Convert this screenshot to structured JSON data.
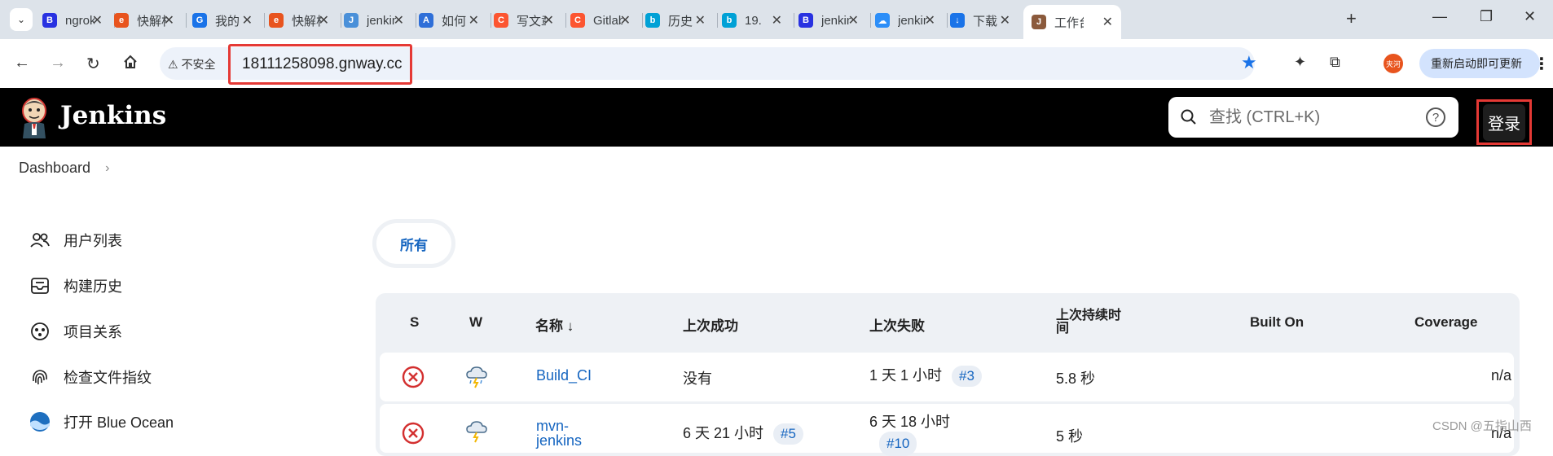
{
  "browser": {
    "tabs": [
      {
        "title": "ngrok",
        "favicon_text": "B",
        "color": "#2932e1"
      },
      {
        "title": "快解析",
        "favicon_text": "e",
        "color": "#e8541e"
      },
      {
        "title": "我的",
        "favicon_text": "G",
        "color": "#1a73e8"
      },
      {
        "title": "快解析",
        "favicon_text": "e",
        "color": "#e8541e"
      },
      {
        "title": "jenkins",
        "favicon_text": "J",
        "color": "#4a90d9"
      },
      {
        "title": "如何",
        "favicon_text": "A",
        "color": "#2f6fd8"
      },
      {
        "title": "写文章",
        "favicon_text": "C",
        "color": "#fc5531"
      },
      {
        "title": "Gitlab",
        "favicon_text": "C",
        "color": "#fc5531"
      },
      {
        "title": "历史",
        "favicon_text": "b",
        "color": "#00a1d6"
      },
      {
        "title": "19.",
        "favicon_text": "b",
        "color": "#00a1d6"
      },
      {
        "title": "jenkins",
        "favicon_text": "B",
        "color": "#2932e1"
      },
      {
        "title": "jenkins",
        "favicon_text": "☁",
        "color": "#2c8ef8"
      },
      {
        "title": "下载",
        "favicon_text": "↓",
        "color": "#1a73e8"
      },
      {
        "title": "工作台",
        "favicon_text": "J",
        "color": "#8b5a3c"
      }
    ],
    "url": "18111258098.gnway.cc",
    "security_label": "不安全",
    "profile_text": "夹河",
    "relaunch_label": "重新启动即可更新"
  },
  "jenkins": {
    "title": "Jenkins",
    "search_placeholder": "查找 (CTRL+K)",
    "login_label": "登录",
    "breadcrumb": "Dashboard",
    "sidebar": [
      {
        "label": "用户列表",
        "icon": "people-icon"
      },
      {
        "label": "构建历史",
        "icon": "inbox-icon"
      },
      {
        "label": "项目关系",
        "icon": "relation-icon"
      },
      {
        "label": "检查文件指纹",
        "icon": "fingerprint-icon"
      },
      {
        "label": "打开 Blue Ocean",
        "icon": "blue-ocean-icon"
      }
    ],
    "view_tab": "所有",
    "columns": [
      "S",
      "W",
      "名称 ↓",
      "上次成功",
      "上次失败",
      "上次持续时\n间",
      "Built On",
      "Coverage"
    ],
    "rows": [
      {
        "name": "Build_CI",
        "last_success": "没有",
        "success_build": "",
        "last_failure": "1 天 1 小时",
        "failure_build": "#3",
        "duration": "5.8 秒",
        "built_on": "",
        "coverage": "n/a"
      },
      {
        "name": "mvn-jenkins",
        "last_success": "6 天 21 小时",
        "success_build": "#5",
        "last_failure": "6 天 18 小时",
        "failure_build": "#10",
        "duration": "5 秒",
        "built_on": "",
        "coverage": "n/a"
      }
    ]
  },
  "watermark": "CSDN @五指山西",
  "colors": {
    "link": "#1565c0",
    "fail": "#d32f2f",
    "highlight": "#e53935",
    "header": "#000000"
  }
}
